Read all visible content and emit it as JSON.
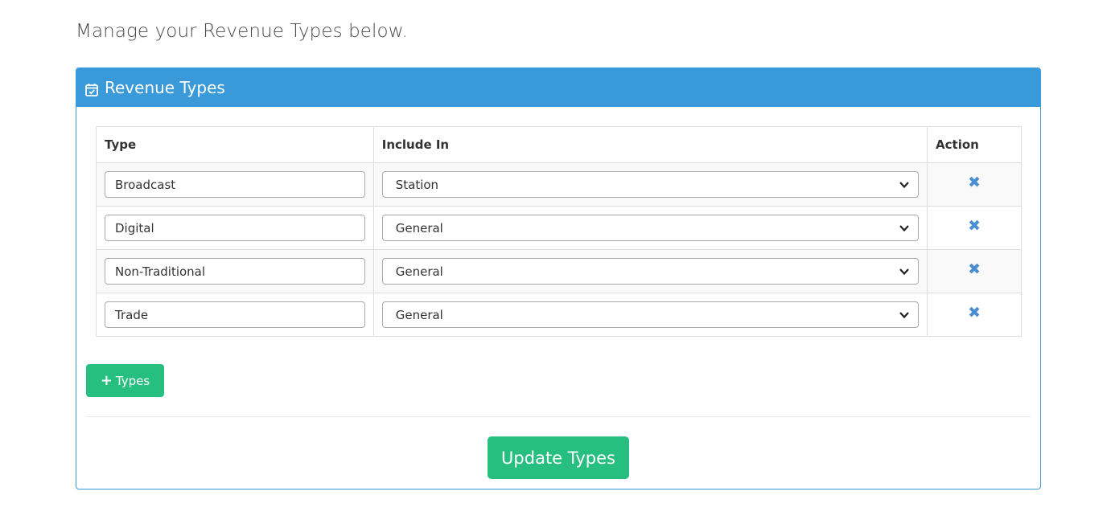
{
  "intro": "Manage your Revenue Types below.",
  "panel": {
    "title": "Revenue Types",
    "icon": "calendar-check-icon",
    "accent": "#3a9ad9"
  },
  "table": {
    "headers": {
      "type": "Type",
      "include_in": "Include In",
      "action": "Action"
    },
    "rows": [
      {
        "type": "Broadcast",
        "include_in": "Station"
      },
      {
        "type": "Digital",
        "include_in": "General"
      },
      {
        "type": "Non-Traditional",
        "include_in": "General"
      },
      {
        "type": "Trade",
        "include_in": "General"
      }
    ],
    "remove_icon": "remove-x-icon"
  },
  "buttons": {
    "add_label": "Types",
    "add_icon": "plus-icon",
    "update_label": "Update Types",
    "color": "#26bf7f"
  }
}
